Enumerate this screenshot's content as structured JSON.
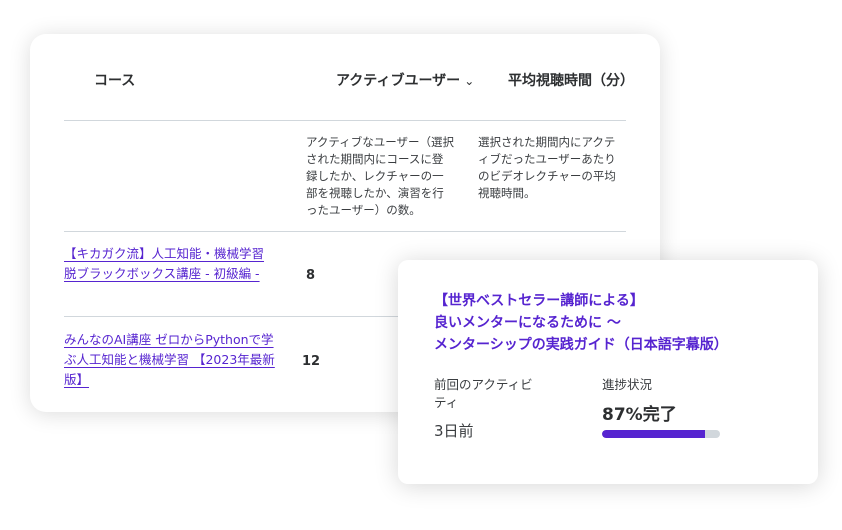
{
  "table": {
    "headers": {
      "course": "コース",
      "active_users": "アクティブユーザー",
      "active_users_sort_icon": "chevron-down-icon",
      "avg_watch_time": "平均視聴時間（分）"
    },
    "descriptions": {
      "active_users": "アクティブなユーザー（選択された期間内にコースに登録したか、レクチャーの一部を視聴したか、演習を行ったユーザー）の数。",
      "avg_watch_time": "選択された期間内にアクティブだったユーザーあたりのビデオレクチャーの平均視聴時間。"
    },
    "rows": [
      {
        "course": "【キカガク流】人工知能・機械学習 脱ブラックボックス講座 - 初級編 -",
        "active_users": "8"
      },
      {
        "course": "みんなのAI講座 ゼロからPythonで学ぶ人工知能と機械学習 【2023年最新版】",
        "active_users": "12"
      }
    ]
  },
  "course_card": {
    "title_lines": [
      "【世界ベストセラー講師による】",
      "良いメンターになるために 〜",
      "メンターシップの実践ガイド（日本語字幕版）"
    ],
    "last_activity_label": "前回のアクティビティ",
    "last_activity_value": "3日前",
    "progress_label": "進捗状況",
    "progress_text": "87%完了",
    "progress_percent": 87
  },
  "colors": {
    "accent": "#5624d0",
    "track": "#d1d7dc",
    "text": "#2d2f31"
  }
}
